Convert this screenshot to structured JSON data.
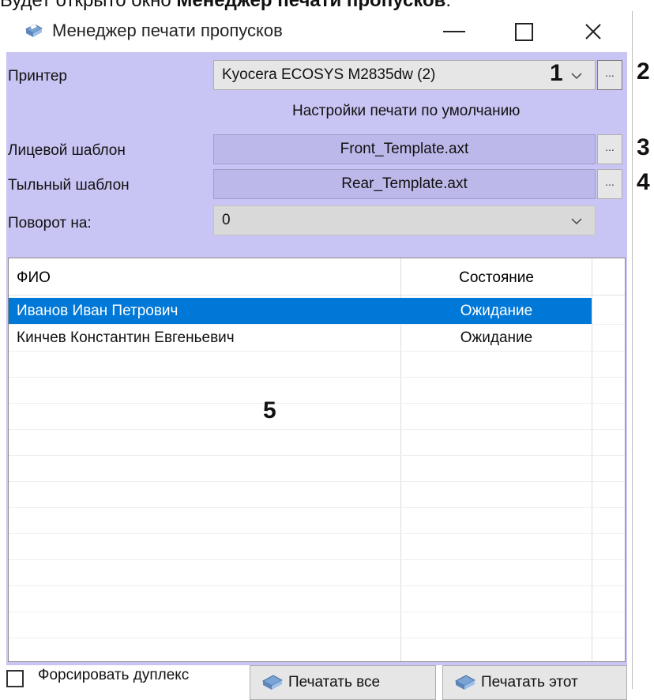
{
  "caption": {
    "prefix": "Будет открыто окно ",
    "bold": "Менеджер печати пропусков",
    "suffix": "."
  },
  "window": {
    "title": "Менеджер печати пропусков",
    "icon": "printer-icon"
  },
  "form": {
    "printer_label": "Принтер",
    "printer_value": "Kyocera ECOSYS M2835dw (2)",
    "default_settings": "Настройки печати по умолчанию",
    "front_label": "Лицевой шаблон",
    "front_value": "Front_Template.axt",
    "rear_label": "Тыльный шаблон",
    "rear_value": "Rear_Template.axt",
    "rotate_label": "Поворот на:",
    "rotate_value": "0",
    "browse_label": "..."
  },
  "markers": [
    "1",
    "2",
    "3",
    "4",
    "5"
  ],
  "list": {
    "columns": [
      "ФИО",
      "Состояние"
    ],
    "rows": [
      {
        "name": "Иванов Иван Петрович",
        "status": "Ожидание",
        "selected": true
      },
      {
        "name": "Кинчев Константин Евгеньевич",
        "status": "Ожидание",
        "selected": false
      }
    ]
  },
  "footer": {
    "duplex_label": "Форсировать дуплекс",
    "print_all": "Печатать все",
    "print_this": "Печатать этот"
  },
  "colors": {
    "panel": "#c8c4f3",
    "selection": "#0078d7"
  }
}
